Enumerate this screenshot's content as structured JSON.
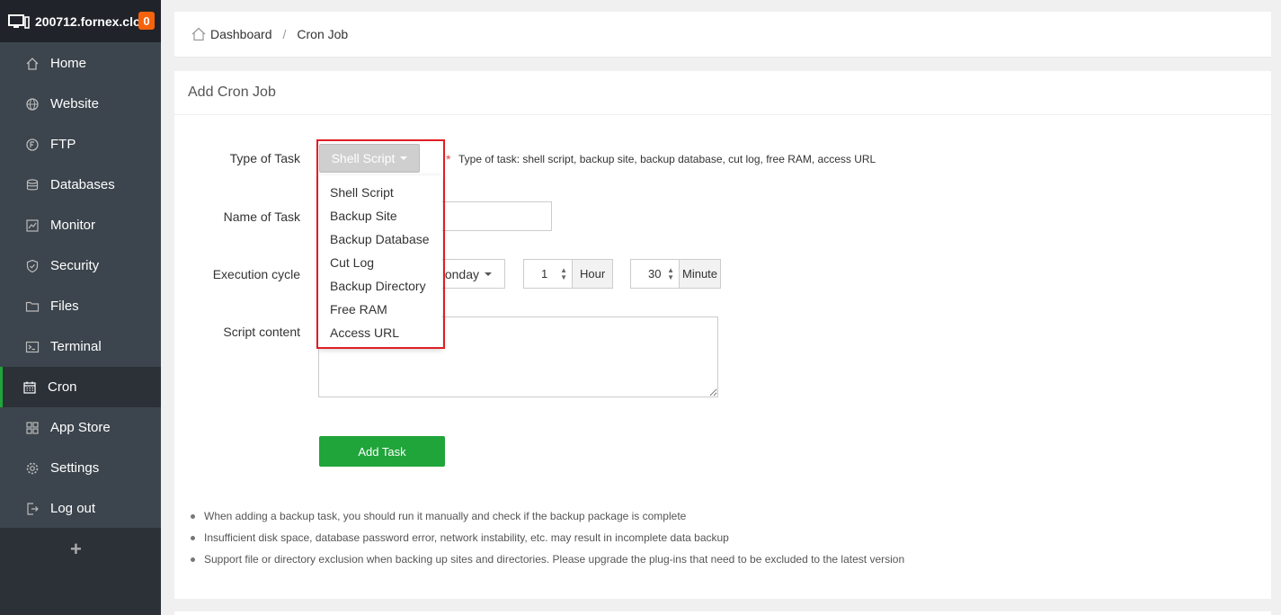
{
  "app": {
    "host": "200712.fornex.clo",
    "badge_count": "0",
    "accent_color": "#20a53a"
  },
  "sidebar": {
    "items": [
      {
        "label": "Home",
        "icon": "home-icon"
      },
      {
        "label": "Website",
        "icon": "globe-icon"
      },
      {
        "label": "FTP",
        "icon": "ftp-icon"
      },
      {
        "label": "Databases",
        "icon": "database-icon"
      },
      {
        "label": "Monitor",
        "icon": "monitor-chart-icon"
      },
      {
        "label": "Security",
        "icon": "shield-icon"
      },
      {
        "label": "Files",
        "icon": "folder-icon"
      },
      {
        "label": "Terminal",
        "icon": "terminal-icon"
      },
      {
        "label": "Cron",
        "icon": "calendar-icon",
        "active": true
      },
      {
        "label": "App Store",
        "icon": "grid-icon"
      },
      {
        "label": "Settings",
        "icon": "gear-icon"
      },
      {
        "label": "Log out",
        "icon": "logout-icon"
      }
    ],
    "add_label": "+"
  },
  "breadcrumb": {
    "home": "Dashboard",
    "separator": "/",
    "current": "Cron Job"
  },
  "form": {
    "title": "Add Cron Job",
    "type_label": "Type of Task",
    "type_value": "Shell Script",
    "required_mark": "*",
    "type_hint": "Type of task: shell script, backup site, backup database, cut log, free RAM, access URL",
    "name_label": "Name of Task",
    "name_value": "",
    "cycle_label": "Execution cycle",
    "cycle_value": "onday",
    "hour_value": "1",
    "hour_unit": "Hour",
    "minute_value": "30",
    "minute_unit": "Minute",
    "script_label": "Script content",
    "script_value": "",
    "add_button": "Add Task"
  },
  "dropdown": {
    "options": [
      "Shell Script",
      "Backup Site",
      "Backup Database",
      "Cut Log",
      "Backup Directory",
      "Free RAM",
      "Access URL"
    ]
  },
  "notes": [
    "When adding a backup task, you should run it manually and check if the backup package is complete",
    "Insufficient disk space, database password error, network instability, etc. may result in incomplete data backup",
    "Support file or directory exclusion when backing up sites and directories. Please upgrade the plug-ins that need to be excluded to the latest version"
  ]
}
